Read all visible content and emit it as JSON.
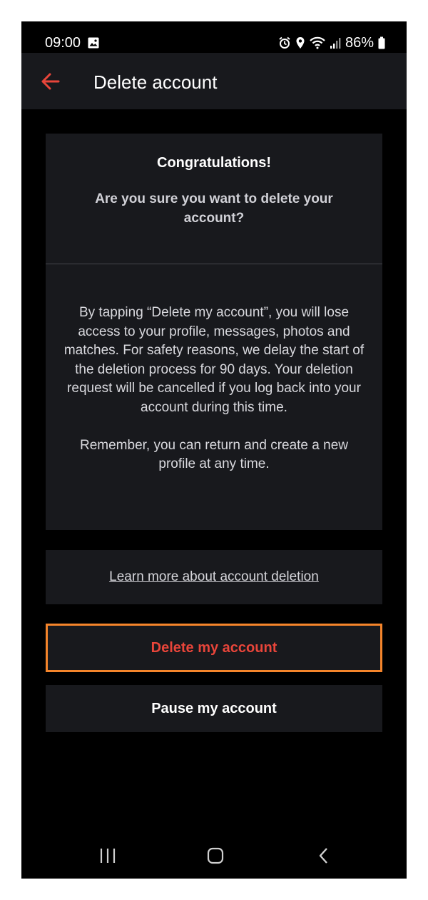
{
  "status_bar": {
    "time": "09:00",
    "battery": "86%",
    "icons": [
      "image-icon",
      "alarm-icon",
      "location-icon",
      "wifi-icon",
      "signal-icon",
      "battery-icon"
    ]
  },
  "app_bar": {
    "title": "Delete account",
    "back_icon": "arrow-left-icon",
    "accent_color": "#e8453a"
  },
  "card": {
    "heading": "Congratulations!",
    "question": "Are you sure you want to delete your account?",
    "body_paragraph_1": "By tapping “Delete my account”, you will lose access to your profile, messages, photos and matches. For safety reasons, we delay the start of the deletion process for 90 days. Your deletion request will be cancelled if you log back into your account during this time.",
    "body_paragraph_2": "Remember, you can return and create a new profile at any time."
  },
  "learn_more_link": "Learn more about account deletion",
  "buttons": {
    "delete_label": "Delete my account",
    "pause_label": "Pause my account",
    "delete_highlight_color": "#f5852b"
  },
  "nav_bar": {
    "icons": [
      "recent-apps-icon",
      "home-icon",
      "back-icon"
    ]
  }
}
